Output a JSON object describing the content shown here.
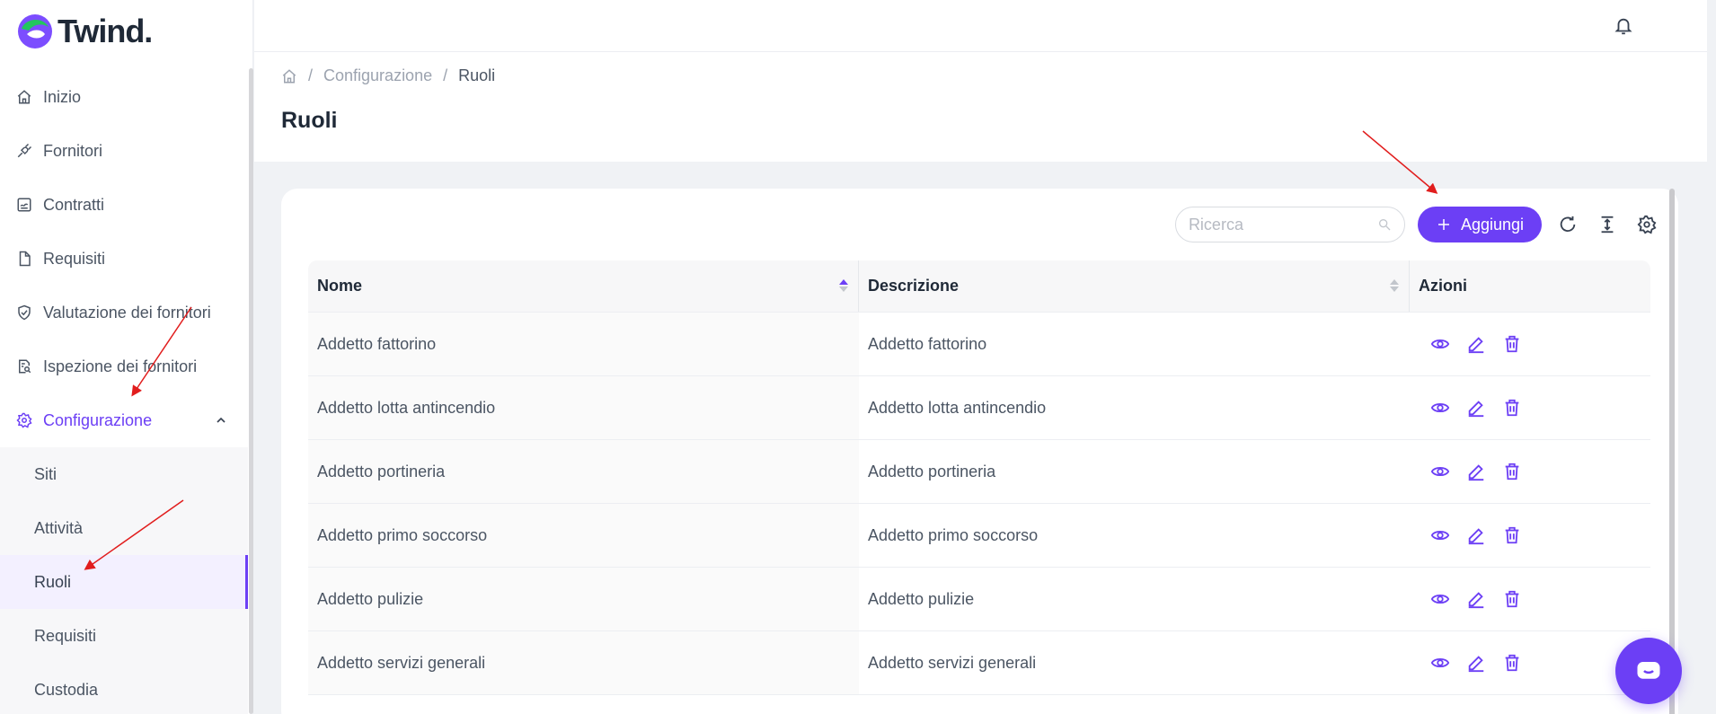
{
  "app": {
    "brand": "Twind.",
    "accent_color": "#6c3ff5"
  },
  "sidebar": {
    "items": [
      {
        "label": "Inizio",
        "icon": "home-icon"
      },
      {
        "label": "Fornitori",
        "icon": "plug-icon"
      },
      {
        "label": "Contratti",
        "icon": "contract-icon"
      },
      {
        "label": "Requisiti",
        "icon": "document-icon"
      },
      {
        "label": "Valutazione dei fornitori",
        "icon": "shield-check-icon"
      },
      {
        "label": "Ispezione dei fornitori",
        "icon": "inspect-icon"
      },
      {
        "label": "Configurazione",
        "icon": "gear-icon",
        "expanded": true
      }
    ],
    "sub_items": [
      {
        "label": "Siti"
      },
      {
        "label": "Attività"
      },
      {
        "label": "Ruoli",
        "active": true
      },
      {
        "label": "Requisiti"
      },
      {
        "label": "Custodia"
      }
    ]
  },
  "breadcrumb": {
    "parent": "Configurazione",
    "current": "Ruoli",
    "separator": "/"
  },
  "page": {
    "title": "Ruoli"
  },
  "toolbar": {
    "search_placeholder": "Ricerca",
    "add_label": "Aggiungi"
  },
  "table": {
    "columns": [
      "Nome",
      "Descrizione",
      "Azioni"
    ],
    "rows": [
      {
        "nome": "Addetto fattorino",
        "descrizione": "Addetto fattorino"
      },
      {
        "nome": "Addetto lotta antincendio",
        "descrizione": "Addetto lotta antincendio"
      },
      {
        "nome": "Addetto portineria",
        "descrizione": "Addetto portineria"
      },
      {
        "nome": "Addetto primo soccorso",
        "descrizione": "Addetto primo soccorso"
      },
      {
        "nome": "Addetto pulizie",
        "descrizione": "Addetto pulizie"
      },
      {
        "nome": "Addetto servizi generali",
        "descrizione": "Addetto servizi generali"
      }
    ]
  }
}
